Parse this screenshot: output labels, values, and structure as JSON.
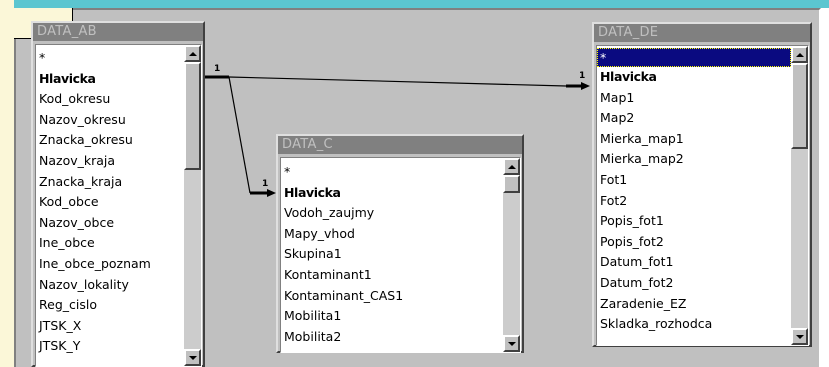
{
  "tables": {
    "data_ab": {
      "title": "DATA_AB",
      "fields": [
        "*",
        "Hlavicka",
        "Kod_okresu",
        "Nazov_okresu",
        "Znacka_okresu",
        "Nazov_kraja",
        "Znacka_kraja",
        "Kod_obce",
        "Nazov_obce",
        "Ine_obce",
        "Ine_obce_poznam",
        "Nazov_lokality",
        "Reg_cislo",
        "JTSK_X",
        "JTSK_Y"
      ]
    },
    "data_c": {
      "title": "DATA_C",
      "fields": [
        "*",
        "Hlavicka",
        "Vodoh_zaujmy",
        "Mapy_vhod",
        "Skupina1",
        "Kontaminant1",
        "Kontaminant_CAS1",
        "Mobilita1",
        "Mobilita2"
      ]
    },
    "data_de": {
      "title": "DATA_DE",
      "fields": [
        "*",
        "Hlavicka",
        "Map1",
        "Map2",
        "Mierka_map1",
        "Mierka_map2",
        "Fot1",
        "Fot2",
        "Popis_fot1",
        "Popis_fot2",
        "Datum_fot1",
        "Datum_fot2",
        "Zaradenie_EZ",
        "Skladka_rozhodca"
      ]
    }
  },
  "relationships": [
    {
      "from": "DATA_AB.Hlavicka",
      "to": "DATA_DE.Hlavicka",
      "from_cardinality": "1",
      "to_cardinality": "1"
    },
    {
      "from": "DATA_AB.Hlavicka",
      "to": "DATA_C.Hlavicka",
      "from_cardinality": "1",
      "to_cardinality": "1"
    }
  ],
  "selected_field": "DATA_DE.*",
  "colors": {
    "selection": "#0a0a80",
    "canvas": "#c0c0c0",
    "title_bar_inactive": "#808080"
  }
}
